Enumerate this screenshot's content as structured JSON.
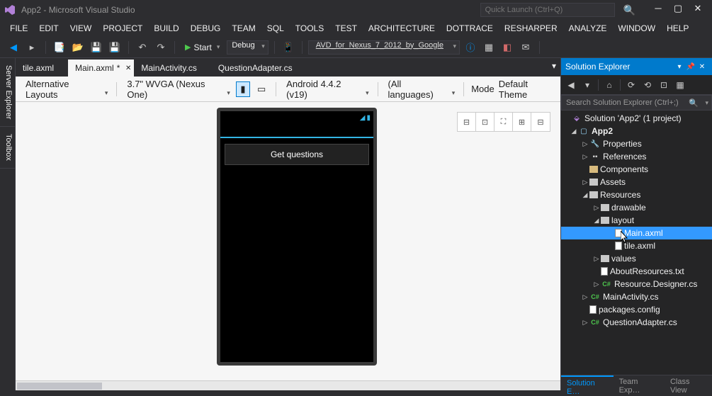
{
  "title": "App2 - Microsoft Visual Studio",
  "quickLaunch": {
    "placeholder": "Quick Launch (Ctrl+Q)"
  },
  "menu": [
    "FILE",
    "EDIT",
    "VIEW",
    "PROJECT",
    "BUILD",
    "DEBUG",
    "TEAM",
    "SQL",
    "TOOLS",
    "TEST",
    "ARCHITECTURE",
    "DOTTRACE",
    "RESHARPER",
    "ANALYZE",
    "WINDOW",
    "HELP"
  ],
  "toolbar": {
    "start": "Start",
    "config": "Debug",
    "avd": "AVD_for_Nexus_7_2012_by_Google"
  },
  "sideTabs": [
    "Server Explorer",
    "Toolbox"
  ],
  "docTabs": [
    {
      "label": "tile.axml",
      "active": false
    },
    {
      "label": "Main.axml",
      "active": true,
      "dirty": true
    },
    {
      "label": "MainActivity.cs",
      "active": false
    },
    {
      "label": "QuestionAdapter.cs",
      "active": false
    }
  ],
  "designerToolbar": {
    "altLayouts": "Alternative Layouts",
    "device": "3.7\" WVGA (Nexus One)",
    "android": "Android 4.4.2 (v19)",
    "lang": "(All languages)",
    "mode": "Mode",
    "theme": "Default Theme"
  },
  "phone": {
    "button": "Get questions"
  },
  "solExp": {
    "title": "Solution Explorer",
    "searchPlaceholder": "Search Solution Explorer (Ctrl+;)",
    "solution": "Solution 'App2' (1 project)",
    "project": "App2",
    "nodes": {
      "properties": "Properties",
      "references": "References",
      "components": "Components",
      "assets": "Assets",
      "resources": "Resources",
      "drawable": "drawable",
      "layout": "layout",
      "mainAxml": "Main.axml",
      "tileAxml": "tile.axml",
      "values": "values",
      "aboutRes": "AboutResources.txt",
      "resDesigner": "Resource.Designer.cs",
      "mainActivity": "MainActivity.cs",
      "packages": "packages.config",
      "questionAdapter": "QuestionAdapter.cs"
    },
    "bottomTabs": [
      "Solution E…",
      "Team Exp…",
      "Class View"
    ]
  }
}
